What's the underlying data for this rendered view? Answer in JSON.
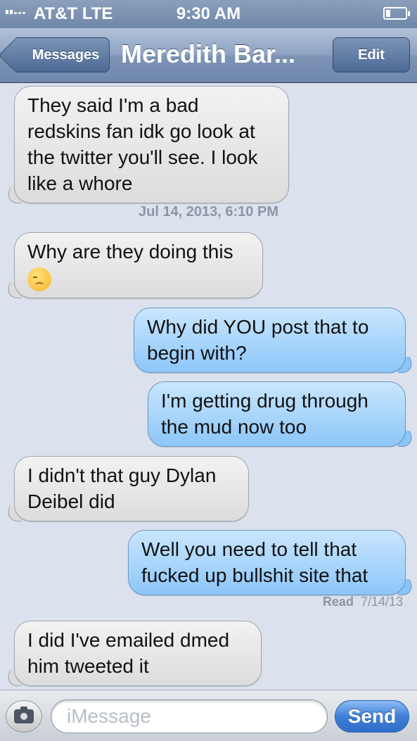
{
  "status_bar": {
    "carrier": "AT&T  LTE",
    "time": "9:30 AM"
  },
  "nav": {
    "back_label": "Messages",
    "title": "Meredith Bar...",
    "edit_label": "Edit"
  },
  "messages": [
    {
      "direction": "incoming",
      "text": "They said I'm a bad redskins fan idk go look at the twitter you'll see. I look like a whore"
    },
    {
      "direction": "incoming",
      "text": "Why are they doing this",
      "emoji": "disappointed-face-icon"
    },
    {
      "direction": "outgoing",
      "text": "Why did YOU post that to begin with?"
    },
    {
      "direction": "outgoing",
      "text": "I'm getting drug through the mud now too"
    },
    {
      "direction": "incoming",
      "text": "I didn't that guy Dylan Deibel did"
    },
    {
      "direction": "outgoing",
      "text": "Well you need to tell that fucked up bullshit site that"
    },
    {
      "direction": "incoming",
      "text": "I did I've emailed dmed him tweeted it"
    }
  ],
  "timestamp": "Jul 14, 2013, 6:10 PM",
  "read_receipt": {
    "label": "Read",
    "date": "7/14/13"
  },
  "input_bar": {
    "placeholder": "iMessage",
    "send_label": "Send",
    "camera_icon": "camera-icon"
  },
  "colors": {
    "incoming_bubble": "#e6e6e6",
    "outgoing_bubble": "#a9d5fb",
    "background": "#dbe2ed",
    "send_button": "#3f7fd6"
  }
}
